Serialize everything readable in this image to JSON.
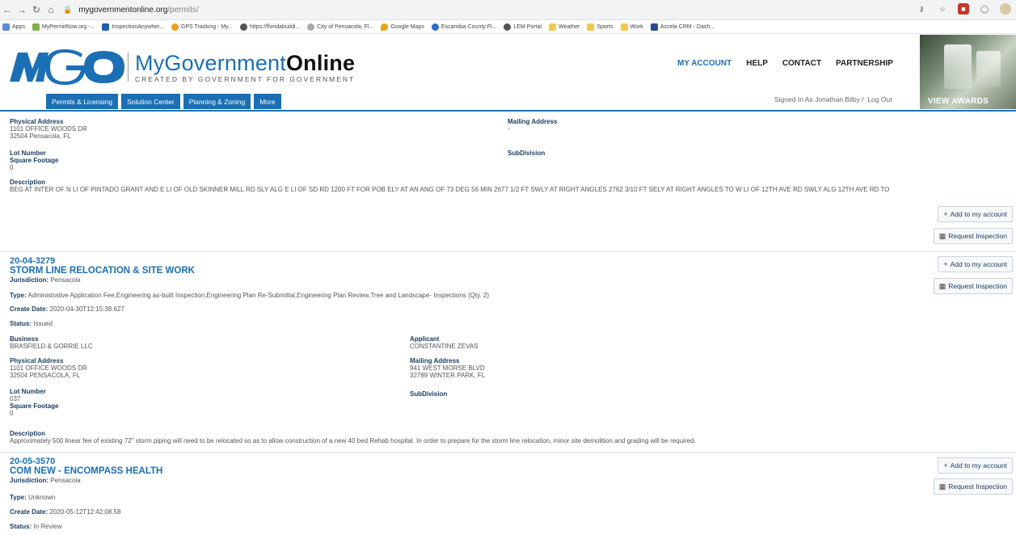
{
  "browser": {
    "url_host": "mygovernmentonline.org",
    "url_path": "/permits/",
    "bookmarks": [
      "Apps",
      "MyPermitNow.org -...",
      "InspectionAnywher...",
      "GPS Tracking - My...",
      "https://floridabuildi...",
      "City of Pensacola, Fl...",
      "Google Maps",
      "Escambia County Fl...",
      "LEM Portal",
      "Weather",
      "Sports",
      "Work",
      "Accela CRM - Dash..."
    ]
  },
  "header": {
    "logo_main_light": "MyGovernment",
    "logo_main_bold": "Online",
    "logo_sub": "CREATED BY GOVERNMENT FOR GOVERNMENT",
    "top_links": [
      "MY ACCOUNT",
      "HELP",
      "CONTACT",
      "PARTNERSHIP"
    ],
    "tabs": [
      "Permits & Licensing",
      "Solution Center",
      "Planning & Zoning",
      "More"
    ],
    "signed_in": "Signed In As Jonathan Bilby /",
    "logout": "Log Out",
    "awards": "VIEW AWARDS"
  },
  "buttons": {
    "add": "Add to my account",
    "inspect": "Request Inspection"
  },
  "labels": {
    "physical_address": "Physical Address",
    "mailing_address": "Mailing Address",
    "lot_number": "Lot Number",
    "square_footage": "Square Footage",
    "subdivision": "SubDivision",
    "description": "Description",
    "jurisdiction": "Jurisdiction:",
    "type": "Type:",
    "create_date": "Create Date:",
    "status": "Status:",
    "business": "Business",
    "applicant": "Applicant"
  },
  "card0": {
    "phys_line1": "1101 OFFICE WOODS DR",
    "phys_line2": "32504 Pensacola, FL",
    "mailing": "-",
    "square_footage": "0",
    "description": "BEG AT INTER OF N LI OF PINTADO GRANT AND E LI OF OLD SKINNER MILL RD SLY ALG E LI OF SD RD 1200 FT FOR POB ELY AT AN ANG OF 73 DEG 56 MIN 2677 1/2 FT SWLY AT RIGHT ANGLES 2762 3/10 FT SELY AT RIGHT ANGLES TO W LI OF 12TH AVE RD SWLY ALG 12TH AVE RD TO"
  },
  "card1": {
    "number": "20-04-3279",
    "title": "STORM LINE RELOCATION & SITE WORK",
    "jurisdiction": "Pensacola",
    "type": "Administrative Application Fee,Engineering as-built Inspection,Engineering Plan Re-Submittal,Engineering Plan Review,Tree and Landscape- Inspections (Qty. 2)",
    "create_date": "2020-04-30T12:15:38.627",
    "status": "Issued",
    "business": "BRASFIELD & GORRIE LLC",
    "applicant": "CONSTANTINE ZEVAS",
    "phys_line1": "1101 OFFICE WOODS DR",
    "phys_line2": "32504 PENSACOLA, FL",
    "mail_line1": "941 WEST MORSE BLVD",
    "mail_line2": "32789 WINTER PARK, FL",
    "lot_number": "037",
    "square_footage": "0",
    "description": "Approximately 500 linear fee of existing 72\" storm piping will need to be relocated so as to allow construction of a new 40 bed Rehab hospital. In order to prepare for the storm line relocation, minor site demolition and grading will be required."
  },
  "card2": {
    "number": "20-05-3570",
    "title": "COM NEW - ENCOMPASS HEALTH",
    "jurisdiction": "Pensacola",
    "type": "Unknown",
    "create_date": "2020-05-12T12:42:08.58",
    "status": "In Review"
  }
}
